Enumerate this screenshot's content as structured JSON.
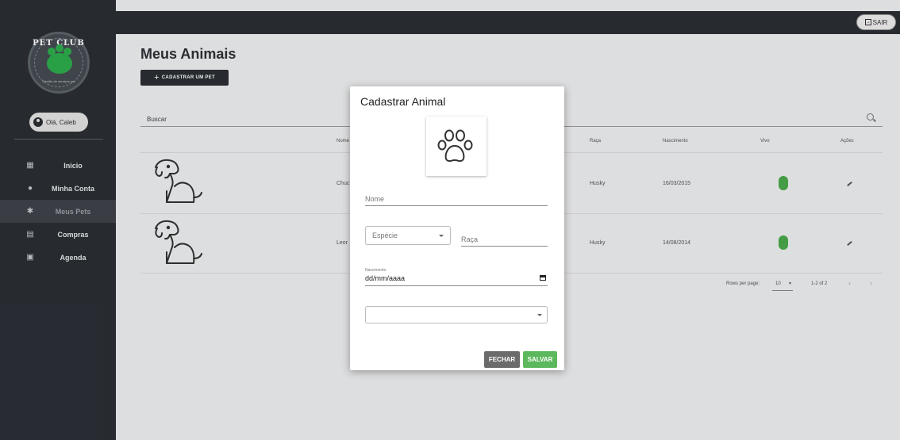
{
  "app": {
    "logo": {
      "title": "PET CLUB",
      "subtitle": "Gestão de serviços pet"
    },
    "greeting": "Olá, Caleb",
    "logout": "SAIR"
  },
  "sidebar": {
    "items": [
      {
        "label": "Inicio",
        "icon": "dashboard-icon"
      },
      {
        "label": "Minha Conta",
        "icon": "account-icon"
      },
      {
        "label": "Meus Pets",
        "icon": "paw-icon",
        "active": true
      },
      {
        "label": "Compras",
        "icon": "purchases-icon"
      },
      {
        "label": "Agenda",
        "icon": "calendar-icon"
      }
    ]
  },
  "main": {
    "title": "Meus Animais",
    "add_button": "CADASTRAR UM PET",
    "search_placeholder": "Buscar",
    "table": {
      "headers": {
        "nome": "Nome",
        "raca": "Raça",
        "nascimento": "Nascimento",
        "vivo": "Vivo",
        "acoes": "Ações"
      },
      "rows": [
        {
          "nome": "Chuc",
          "raca": "Husky",
          "nascimento": "16/03/2015",
          "vivo": true
        },
        {
          "nome": "Leor",
          "raca": "Husky",
          "nascimento": "14/08/2014",
          "vivo": true
        }
      ]
    },
    "pagination": {
      "rows_per_page_label": "Rows per page:",
      "rows_per_page": "10",
      "range": "1-2 of 2"
    }
  },
  "modal": {
    "title": "Cadastrar Animal",
    "fields": {
      "nome_label": "Nome",
      "especie_label": "Espécie",
      "raca_label": "Raça",
      "nascimento_label": "Nascimento",
      "nascimento_value": "dd/mm/aaaa",
      "extra_select_value": ""
    },
    "buttons": {
      "close": "FECHAR",
      "save": "SALVAR"
    }
  },
  "colors": {
    "sidebar": "#2b2f35",
    "accent_green": "#5cb85c",
    "status_green": "#4aaa4a"
  }
}
